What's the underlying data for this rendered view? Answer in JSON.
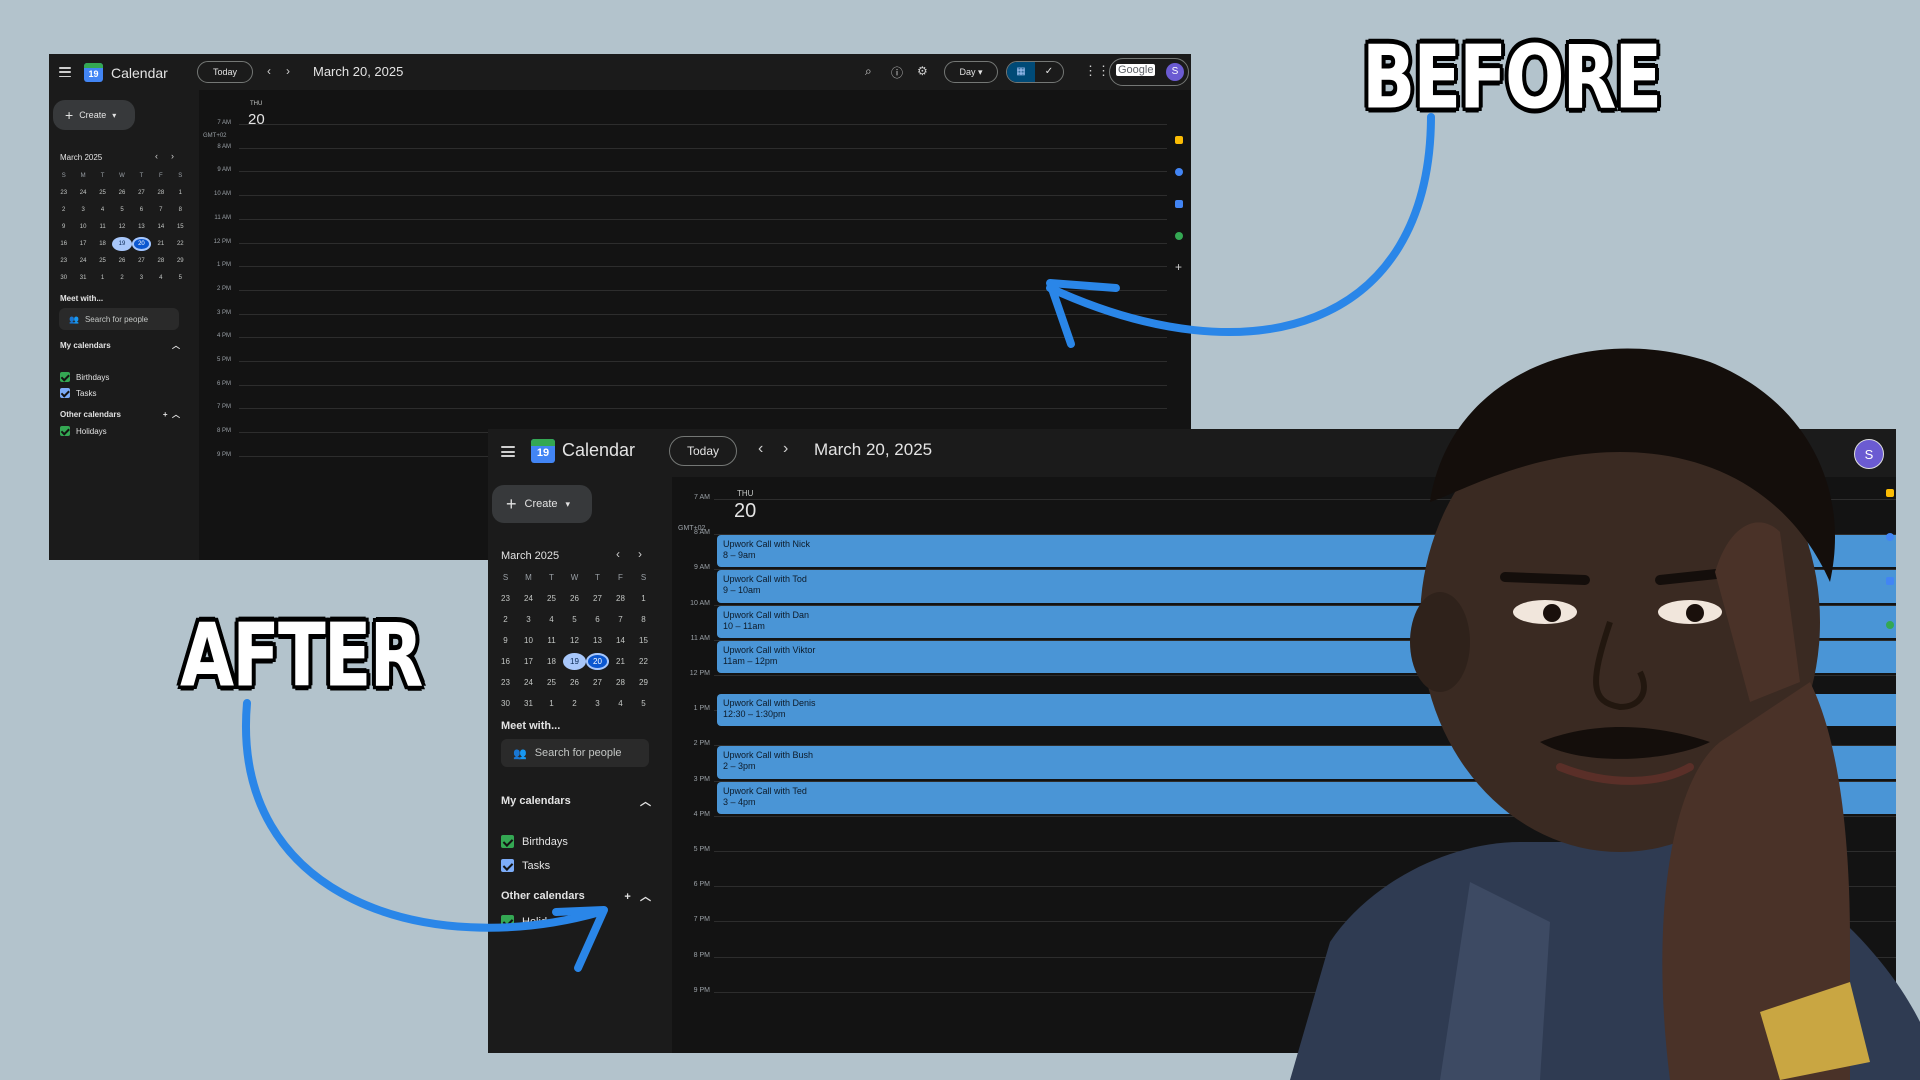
{
  "captions": {
    "before": "BEFORE",
    "after": "AFTER"
  },
  "before": {
    "app_name": "Calendar",
    "logo_day": "19",
    "today_label": "Today",
    "date_title": "March 20, 2025",
    "view_label": "Day",
    "account_brand": "Google",
    "account_initial": "S",
    "create_label": "Create",
    "mini_month": "March 2025",
    "meet_with": "Meet with...",
    "search_people": "Search for people",
    "my_calendars": "My calendars",
    "other_calendars": "Other calendars",
    "calendars": [
      "Birthdays",
      "Tasks"
    ],
    "other": [
      "Holidays"
    ],
    "day_name": "THU",
    "day_number": "20",
    "timezone": "GMT+02",
    "hours": [
      "7 AM",
      "8 AM",
      "9 AM",
      "10 AM",
      "11 AM",
      "12 PM",
      "1 PM",
      "2 PM",
      "3 PM",
      "4 PM",
      "5 PM",
      "6 PM",
      "7 PM",
      "8 PM",
      "9 PM"
    ]
  },
  "after": {
    "app_name": "Calendar",
    "logo_day": "19",
    "today_label": "Today",
    "date_title": "March 20, 2025",
    "account_initial": "S",
    "create_label": "Create",
    "mini_month": "March 2025",
    "meet_with": "Meet with...",
    "search_people": "Search for people",
    "my_calendars": "My calendars",
    "other_calendars": "Other calendars",
    "calendars": [
      "Birthdays",
      "Tasks"
    ],
    "other": [
      "Holida"
    ],
    "day_name": "THU",
    "day_number": "20",
    "timezone": "GMT+02",
    "hours": [
      "7 AM",
      "8 AM",
      "9 AM",
      "10 AM",
      "11 AM",
      "12 PM",
      "1 PM",
      "2 PM",
      "3 PM",
      "4 PM",
      "5 PM",
      "6 PM",
      "7 PM",
      "8 PM",
      "9 PM"
    ],
    "events": [
      {
        "title": "Upwork Call with Nick",
        "time": "8 – 9am"
      },
      {
        "title": "Upwork Call with Tod",
        "time": "9 – 10am"
      },
      {
        "title": "Upwork Call with Dan",
        "time": "10 – 11am"
      },
      {
        "title": "Upwork Call with Viktor",
        "time": "11am – 12pm"
      },
      {
        "title": "Upwork Call with Denis",
        "time": "12:30 – 1:30pm"
      },
      {
        "title": "Upwork Call with Bush",
        "time": "2 – 3pm"
      },
      {
        "title": "Upwork Call with Ted",
        "time": "3 – 4pm"
      }
    ]
  },
  "mini_calendar": {
    "weekdays": [
      "S",
      "M",
      "T",
      "W",
      "T",
      "F",
      "S"
    ],
    "weeks": [
      [
        "23",
        "24",
        "25",
        "26",
        "27",
        "28",
        "1"
      ],
      [
        "2",
        "3",
        "4",
        "5",
        "6",
        "7",
        "8"
      ],
      [
        "9",
        "10",
        "11",
        "12",
        "13",
        "14",
        "15"
      ],
      [
        "16",
        "17",
        "18",
        "19",
        "20",
        "21",
        "22"
      ],
      [
        "23",
        "24",
        "25",
        "26",
        "27",
        "28",
        "29"
      ],
      [
        "30",
        "31",
        "1",
        "2",
        "3",
        "4",
        "5"
      ]
    ],
    "today": "19",
    "selected": "20"
  },
  "colors": {
    "background": "#b3c3cc",
    "event": "#4a95d6",
    "arrow": "#2a86e8",
    "checkbox_birthdays": "#34a853",
    "checkbox_tasks": "#7cacf8",
    "checkbox_holidays": "#34a853"
  },
  "icons": {
    "menu": "menu-icon",
    "search": "search-icon",
    "help": "help-icon",
    "settings": "gear-icon",
    "apps": "apps-grid-icon",
    "people": "people-icon"
  }
}
